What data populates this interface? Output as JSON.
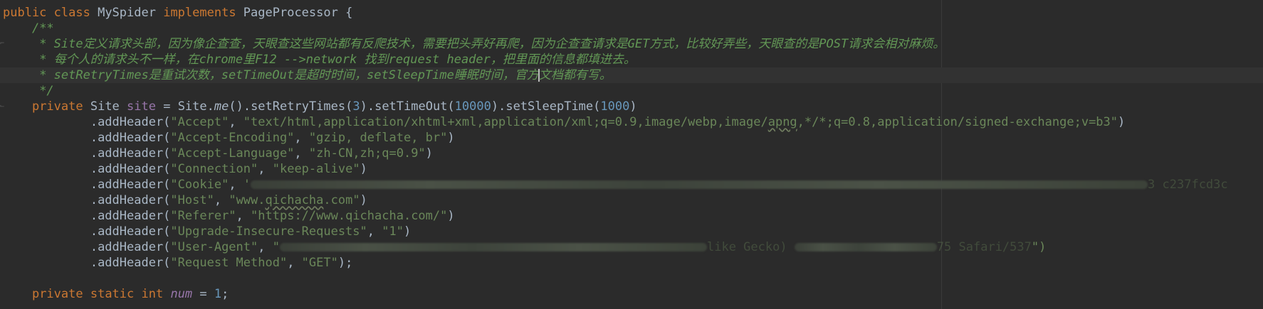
{
  "code": {
    "l1": {
      "kw_public": "public ",
      "kw_class": "class ",
      "class_name": "MySpider ",
      "kw_implements": "implements ",
      "iface": "PageProcessor {"
    },
    "l2": "/**",
    "l3": " * Site定义请求头部，因为像企查查，天眼查这些网站都有反爬技术，需要把头弄好再爬，因为企查查请求是GET方式，比较好弄些，天眼查的是POST请求会相对麻烦。",
    "l4": " * 每个人的请求头不一样，在chrome里F12 -->network 找到request header，把里面的信息都填进去。",
    "l5_a": " * setRetryTimes是重试次数，setTimeOut是超时时间，setSleepTime睡眠时间，官方",
    "l5_b": "文档都有写。",
    "l6": " */",
    "l7": {
      "kw_private": "private ",
      "type": "Site ",
      "field": "site",
      "eq": " = Site.",
      "me": "me",
      "call1": "().setRetryTimes(",
      "n1": "3",
      "call2": ").setTimeOut(",
      "n2": "10000",
      "call3": ").setSleepTime(",
      "n3": "1000",
      "close": ")"
    },
    "headers": [
      {
        "prefix": ".addHeader(",
        "key": "\"Accept\"",
        "sep": ", ",
        "value_pre": "\"text/html,application/xhtml+xml,application/xml;q=0.9,image/webp,image/",
        "value_wavy": "apng",
        "value_post": ",*/*;q=0.8,application/signed-exchange;v=b3\"",
        "end": ")"
      },
      {
        "prefix": ".addHeader(",
        "key": "\"Accept-Encoding\"",
        "sep": ", ",
        "value": "\"gzip, deflate, br\"",
        "end": ")"
      },
      {
        "prefix": ".addHeader(",
        "key": "\"Accept-Language\"",
        "sep": ", ",
        "value": "\"zh-CN,zh;q=0.9\"",
        "end": ")"
      },
      {
        "prefix": ".addHeader(",
        "key": "\"Connection\"",
        "sep": ", ",
        "value": "\"keep-alive\"",
        "end": ")"
      },
      {
        "prefix": ".addHeader(",
        "key": "\"Cookie\"",
        "sep": ", ",
        "value": "'",
        "tail": "3 c237fcd3c"
      },
      {
        "prefix": ".addHeader(",
        "key": "\"Host\"",
        "sep": ", ",
        "value_pre": "\"www.",
        "value_wavy": "qichacha",
        "value_post": ".com\"",
        "end": ")"
      },
      {
        "prefix": ".addHeader(",
        "key": "\"Referer\"",
        "sep": ", ",
        "value": "\"https://www.qichacha.com/\"",
        "end": ")"
      },
      {
        "prefix": ".addHeader(",
        "key": "\"Upgrade-Insecure-Requests\"",
        "sep": ", ",
        "value": "\"1\"",
        "end": ")"
      },
      {
        "prefix": ".addHeader(",
        "key": "\"User-Agent\"",
        "sep": ", ",
        "value": "\"",
        "mid": "like Gecko) ",
        "tail": "75 Safari/537",
        "tail2": "\")"
      },
      {
        "prefix": ".addHeader(",
        "key": "\"Request Method\"",
        "sep": ", ",
        "value": "\"GET\"",
        "end": ");"
      }
    ],
    "l18": {
      "kw_private": "private ",
      "kw_static": "static ",
      "kw_int": "int ",
      "field": "num",
      "eq": " = ",
      "n": "1",
      "semi": ";"
    }
  }
}
